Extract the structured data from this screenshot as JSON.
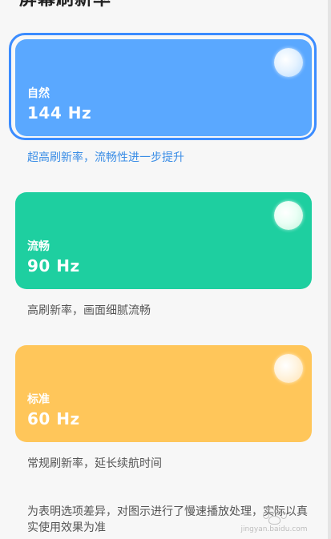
{
  "header": {
    "title": "屏幕刷新率"
  },
  "options": [
    {
      "label": "自然",
      "rate": "144 Hz",
      "description": "超高刷新率，流畅性进一步提升",
      "selected": true,
      "color": "#5aa8ff"
    },
    {
      "label": "流畅",
      "rate": "90 Hz",
      "description": "高刷新率，画面细腻流畅",
      "selected": false,
      "color": "#1ecfa0"
    },
    {
      "label": "标准",
      "rate": "60 Hz",
      "description": "常规刷新率，延长续航时间",
      "selected": false,
      "color": "#ffc65a"
    }
  ],
  "footer": {
    "note": "为表明选项差异，对图示进行了慢速播放处理，实际以真实使用效果为准"
  },
  "watermark": {
    "text": "jingyan.baidu.com"
  },
  "colors": {
    "accent": "#3b8cff",
    "selected_description": "#3a8de6",
    "text_secondary": "#555555",
    "background": "#f7f7f7"
  }
}
